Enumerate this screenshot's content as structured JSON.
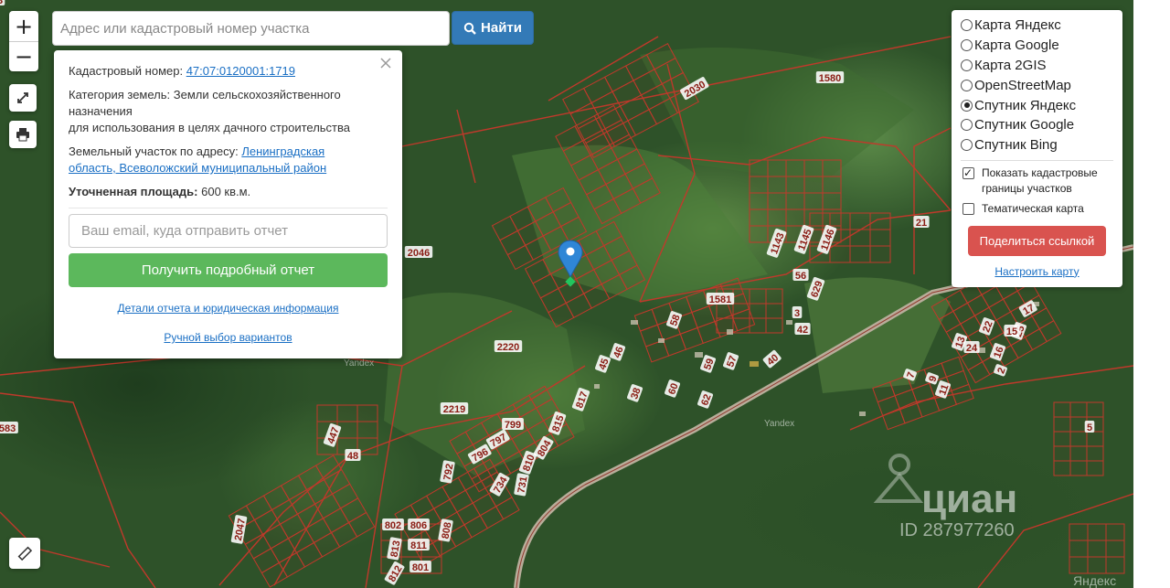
{
  "search": {
    "placeholder": "Адрес или кадастровый номер участка",
    "button_label": "Найти"
  },
  "controls": {
    "zoom_in": "+",
    "zoom_out": "−"
  },
  "popup": {
    "cadastral_label": "Кадастровый номер:",
    "cadastral_value": "47:07:0120001:1719",
    "category_label": "Категория земель:",
    "category_value_1": "Земли сельскохозяйственного",
    "category_value_2": "назначения",
    "category_value_3": "для использования в целях дачного строительства",
    "address_label": "Земельный участок по адресу:",
    "address_value_1": "Ленинградская",
    "address_value_2": "область, Всеволожский муниципальный район",
    "area_label": "Уточненная площадь:",
    "area_value": "600 кв.м.",
    "email_placeholder": "Ваш email, куда отправить отчет",
    "report_button": "Получить подробный отчет",
    "details_link": "Детали отчета и юридическая информация",
    "manual_link": "Ручной выбор вариантов"
  },
  "layers": {
    "options": [
      {
        "label": "Карта Яндекс",
        "selected": false
      },
      {
        "label": "Карта Google",
        "selected": false
      },
      {
        "label": "Карта 2GIS",
        "selected": false
      },
      {
        "label": "OpenStreetMap",
        "selected": false
      },
      {
        "label": "Спутник Яндекс",
        "selected": true
      },
      {
        "label": "Спутник Google",
        "selected": false
      },
      {
        "label": "Спутник Bing",
        "selected": false
      }
    ],
    "show_boundaries_label": "Показать кадастровые границы участков",
    "show_boundaries_checked": true,
    "thematic_label": "Тематическая карта",
    "thematic_checked": false,
    "share_button": "Поделиться ссылкой",
    "configure_link": "Настроить карту"
  },
  "map": {
    "parcel_labels": [
      "1580",
      "2030",
      "2046",
      "1581",
      "2220",
      "2219",
      "1143",
      "1145",
      "1146",
      "56",
      "629",
      "3",
      "42",
      "21",
      "40",
      "57",
      "59",
      "58",
      "60",
      "62",
      "38",
      "46",
      "45",
      "817",
      "815",
      "799",
      "797",
      "796",
      "810",
      "804",
      "792",
      "734",
      "731",
      "802",
      "806",
      "808",
      "811",
      "813",
      "801",
      "812",
      "2047",
      "48",
      "447",
      "583",
      "25",
      "15",
      "13",
      "24",
      "17",
      "16",
      "22",
      "7",
      "9",
      "11",
      "2",
      "5",
      "3"
    ],
    "provider_labels": [
      "Yandex",
      "Yandex"
    ],
    "watermark_brand": "циан",
    "watermark_id": "ID 287977260",
    "corner_logo": "Яндекс",
    "colors": {
      "boundary": "#c0392b",
      "marker": "#2f86d6",
      "marker_point": "#22c55e"
    }
  }
}
